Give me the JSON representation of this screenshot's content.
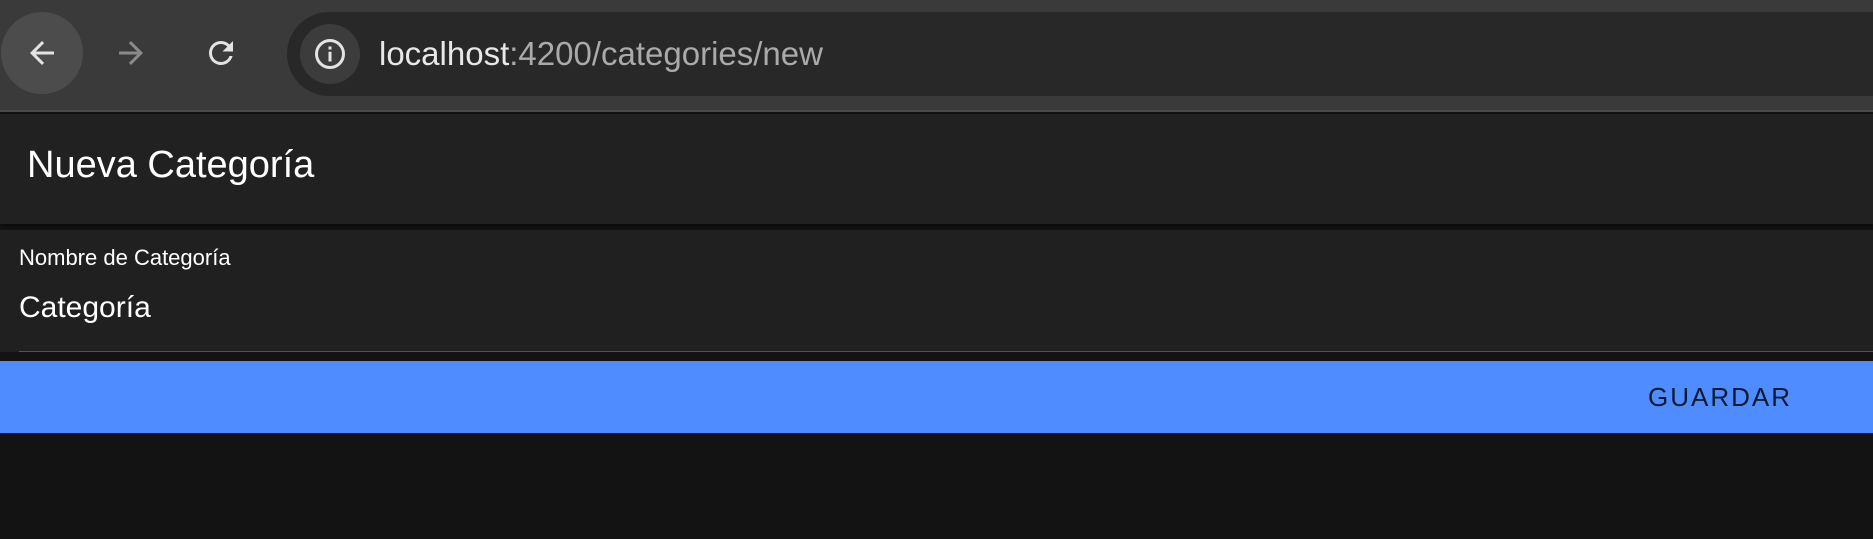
{
  "browser": {
    "url_host": "localhost",
    "url_path": ":4200/categories/new",
    "icons": {
      "back": "arrow-left-icon",
      "forward": "arrow-right-icon",
      "reload": "reload-icon",
      "site_info": "info-icon"
    }
  },
  "page": {
    "title": "Nueva Categoría"
  },
  "form": {
    "name_field": {
      "label": "Nombre de Categoría",
      "value": "Categoría"
    }
  },
  "actions": {
    "save_label": "GUARDAR"
  },
  "colors": {
    "accent": "#4f8cff",
    "background": "#131313",
    "surface": "#212121"
  }
}
